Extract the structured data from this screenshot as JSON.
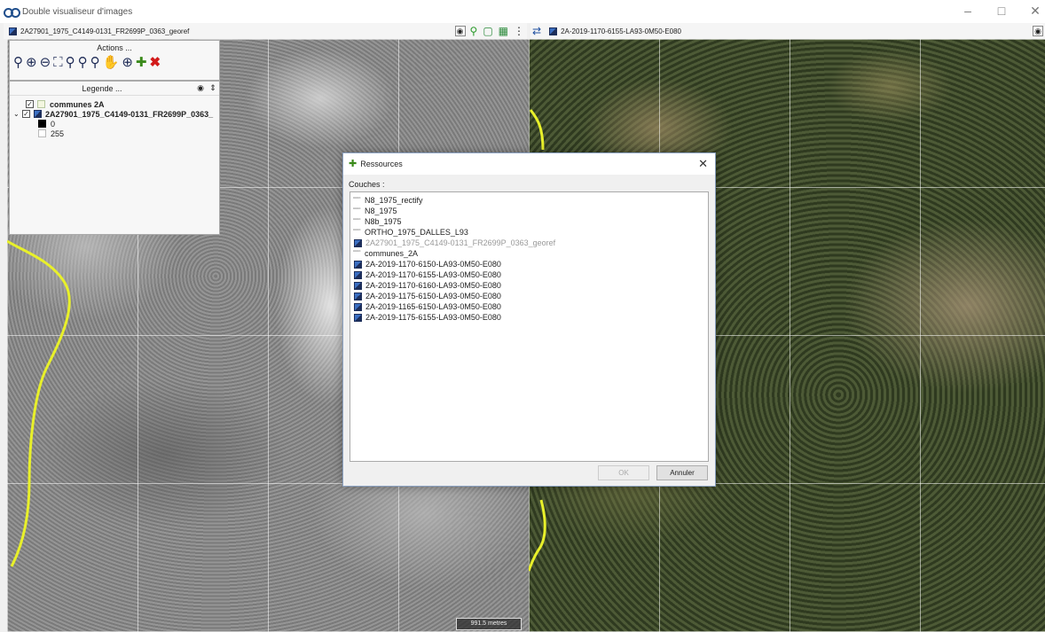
{
  "window": {
    "title": "Double visualiseur d'images",
    "controls": {
      "minimize": "–",
      "maximize": "□",
      "close": "✕"
    }
  },
  "toolbar_left": {
    "layer_name": "2A27901_1975_C4149-0131_FR2699P_0363_georef"
  },
  "toolbar_right": {
    "layer_name": "2A-2019-1170-6155-LA93-0M50-E080"
  },
  "actions_panel": {
    "title": "Actions ..."
  },
  "legend_panel": {
    "title": "Legende ...",
    "items": [
      {
        "label": "communes 2A",
        "checked": true
      },
      {
        "label": "2A27901_1975_C4149-0131_FR2699P_0363_",
        "checked": true
      },
      {
        "label": "0"
      },
      {
        "label": "255"
      }
    ]
  },
  "dialog": {
    "title": "Ressources",
    "section_label": "Couches :",
    "layers": [
      {
        "label": "N8_1975_rectify",
        "type": "vector",
        "enabled": true
      },
      {
        "label": "N8_1975",
        "type": "vector",
        "enabled": true
      },
      {
        "label": "N8b_1975",
        "type": "vector",
        "enabled": true
      },
      {
        "label": "ORTHO_1975_DALLES_L93",
        "type": "vector",
        "enabled": true
      },
      {
        "label": "2A27901_1975_C4149-0131_FR2699P_0363_georef",
        "type": "raster",
        "enabled": false
      },
      {
        "label": "communes_2A",
        "type": "vector",
        "enabled": true
      },
      {
        "label": "2A-2019-1170-6150-LA93-0M50-E080",
        "type": "raster",
        "enabled": true
      },
      {
        "label": "2A-2019-1170-6155-LA93-0M50-E080",
        "type": "raster",
        "enabled": true
      },
      {
        "label": "2A-2019-1170-6160-LA93-0M50-E080",
        "type": "raster",
        "enabled": true
      },
      {
        "label": "2A-2019-1175-6150-LA93-0M50-E080",
        "type": "raster",
        "enabled": true
      },
      {
        "label": "2A-2019-1165-6150-LA93-0M50-E080",
        "type": "raster",
        "enabled": true
      },
      {
        "label": "2A-2019-1175-6155-LA93-0M50-E080",
        "type": "raster",
        "enabled": true
      }
    ],
    "ok_label": "OK",
    "cancel_label": "Annuler"
  },
  "scale_bar": {
    "label": "991.5 metres"
  },
  "colors": {
    "commune_boundary": "#e8f02a",
    "dialog_border": "#8aa0c0"
  }
}
